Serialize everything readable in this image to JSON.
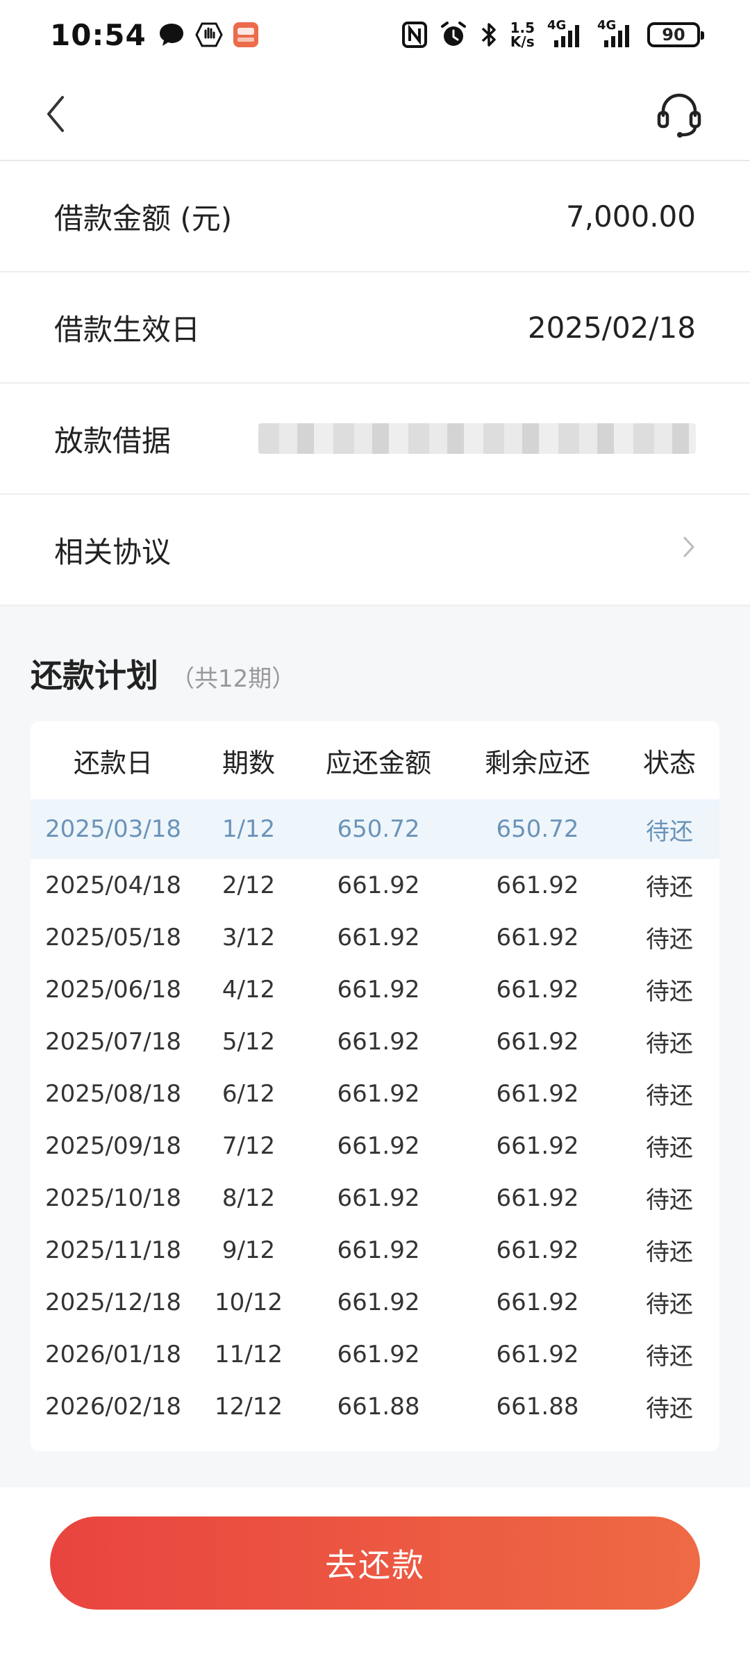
{
  "status_bar": {
    "time": "10:54",
    "net_speed_value": "1.5",
    "net_speed_unit": "K/s",
    "signal_1": "4G",
    "signal_2": "4G",
    "battery": "90"
  },
  "info": {
    "loan_amount_label": "借款金额 (元)",
    "loan_amount_value": "7,000.00",
    "effective_date_label": "借款生效日",
    "effective_date_value": "2025/02/18",
    "receipt_label": "放款借据",
    "agreement_label": "相关协议"
  },
  "plan": {
    "title": "还款计划",
    "count": "（共12期）",
    "headers": [
      "还款日",
      "期数",
      "应还金额",
      "剩余应还",
      "状态"
    ],
    "rows": [
      {
        "date": "2025/03/18",
        "term": "1/12",
        "amount": "650.72",
        "remain": "650.72",
        "status": "待还"
      },
      {
        "date": "2025/04/18",
        "term": "2/12",
        "amount": "661.92",
        "remain": "661.92",
        "status": "待还"
      },
      {
        "date": "2025/05/18",
        "term": "3/12",
        "amount": "661.92",
        "remain": "661.92",
        "status": "待还"
      },
      {
        "date": "2025/06/18",
        "term": "4/12",
        "amount": "661.92",
        "remain": "661.92",
        "status": "待还"
      },
      {
        "date": "2025/07/18",
        "term": "5/12",
        "amount": "661.92",
        "remain": "661.92",
        "status": "待还"
      },
      {
        "date": "2025/08/18",
        "term": "6/12",
        "amount": "661.92",
        "remain": "661.92",
        "status": "待还"
      },
      {
        "date": "2025/09/18",
        "term": "7/12",
        "amount": "661.92",
        "remain": "661.92",
        "status": "待还"
      },
      {
        "date": "2025/10/18",
        "term": "8/12",
        "amount": "661.92",
        "remain": "661.92",
        "status": "待还"
      },
      {
        "date": "2025/11/18",
        "term": "9/12",
        "amount": "661.92",
        "remain": "661.92",
        "status": "待还"
      },
      {
        "date": "2025/12/18",
        "term": "10/12",
        "amount": "661.92",
        "remain": "661.92",
        "status": "待还"
      },
      {
        "date": "2026/01/18",
        "term": "11/12",
        "amount": "661.92",
        "remain": "661.92",
        "status": "待还"
      },
      {
        "date": "2026/02/18",
        "term": "12/12",
        "amount": "661.88",
        "remain": "661.88",
        "status": "待还"
      }
    ]
  },
  "actions": {
    "repay_label": "去还款"
  },
  "colors": {
    "accent_start": "#e9443f",
    "accent_end": "#ee6a44",
    "current_row_text": "#6b93b8",
    "current_row_bg": "#eef6fc"
  }
}
